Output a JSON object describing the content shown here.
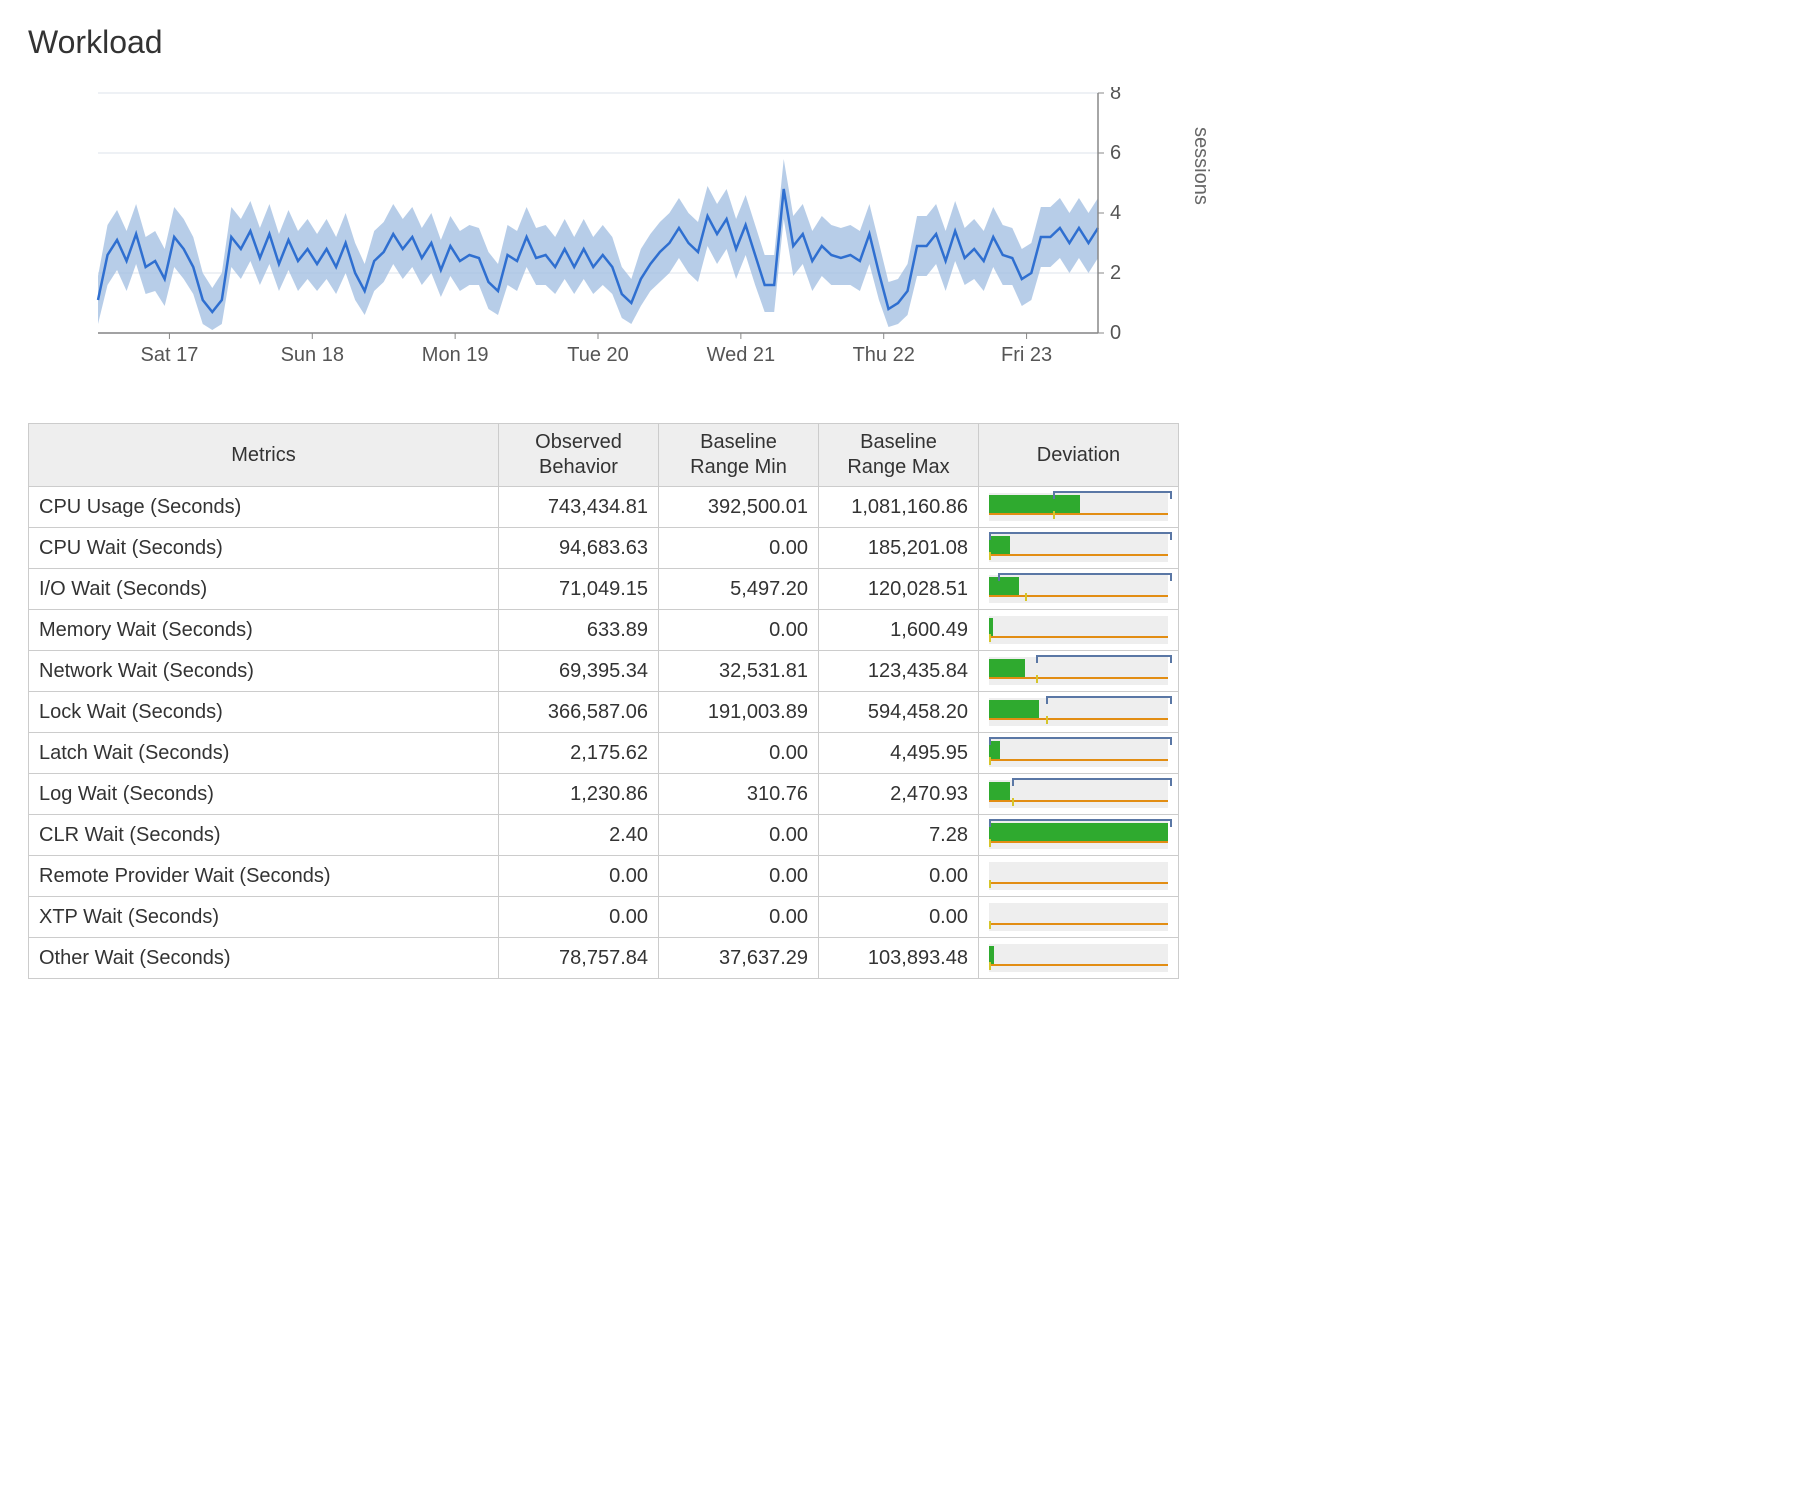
{
  "title": "Workload",
  "chart_axis_label": "sessions",
  "chart_data": {
    "type": "line",
    "title": "",
    "xlabel": "",
    "ylabel": "sessions",
    "ylim": [
      0,
      8
    ],
    "y_ticks": [
      0,
      2,
      4,
      6,
      8
    ],
    "categories": [
      "Sat 17",
      "Sun 18",
      "Mon 19",
      "Tue 20",
      "Wed 21",
      "Thu 22",
      "Fri 23"
    ],
    "series": [
      {
        "name": "sessions",
        "values": [
          1.1,
          2.6,
          3.1,
          2.4,
          3.3,
          2.2,
          2.4,
          1.8,
          3.2,
          2.8,
          2.2,
          1.1,
          0.7,
          1.1,
          3.2,
          2.8,
          3.4,
          2.5,
          3.3,
          2.3,
          3.1,
          2.4,
          2.8,
          2.3,
          2.8,
          2.2,
          3.0,
          2.0,
          1.4,
          2.4,
          2.7,
          3.3,
          2.8,
          3.2,
          2.5,
          3.0,
          2.1,
          2.9,
          2.4,
          2.6,
          2.5,
          1.7,
          1.4,
          2.6,
          2.4,
          3.2,
          2.5,
          2.6,
          2.2,
          2.8,
          2.2,
          2.8,
          2.2,
          2.6,
          2.2,
          1.3,
          1.0,
          1.8,
          2.3,
          2.7,
          3.0,
          3.5,
          3.0,
          2.7,
          3.9,
          3.3,
          3.8,
          2.8,
          3.6,
          2.6,
          1.6,
          1.6,
          4.8,
          2.9,
          3.3,
          2.4,
          2.9,
          2.6,
          2.5,
          2.6,
          2.4,
          3.3,
          2.0,
          0.8,
          1.0,
          1.4,
          2.9,
          2.9,
          3.3,
          2.4,
          3.4,
          2.5,
          2.8,
          2.4,
          3.2,
          2.6,
          2.5,
          1.8,
          2.0,
          3.2,
          3.2,
          3.5,
          3.0,
          3.5,
          3.0,
          3.5
        ]
      },
      {
        "name": "band_lower",
        "values": [
          0.3,
          1.6,
          2.1,
          1.4,
          2.3,
          1.3,
          1.4,
          0.9,
          2.2,
          1.8,
          1.3,
          0.3,
          0.1,
          0.3,
          2.2,
          1.8,
          2.4,
          1.6,
          2.3,
          1.4,
          2.1,
          1.4,
          1.8,
          1.4,
          1.8,
          1.3,
          2.0,
          1.1,
          0.6,
          1.4,
          1.7,
          2.3,
          1.8,
          2.2,
          1.6,
          2.0,
          1.2,
          1.9,
          1.4,
          1.6,
          1.6,
          0.8,
          0.6,
          1.6,
          1.4,
          2.2,
          1.6,
          1.6,
          1.3,
          1.8,
          1.3,
          1.8,
          1.3,
          1.6,
          1.3,
          0.5,
          0.3,
          0.9,
          1.4,
          1.7,
          2.0,
          2.5,
          2.0,
          1.7,
          2.9,
          2.3,
          2.8,
          1.8,
          2.6,
          1.6,
          0.7,
          0.7,
          3.8,
          1.9,
          2.3,
          1.4,
          1.9,
          1.6,
          1.6,
          1.6,
          1.4,
          2.3,
          1.1,
          0.2,
          0.3,
          0.6,
          1.9,
          1.9,
          2.3,
          1.4,
          2.4,
          1.6,
          1.8,
          1.4,
          2.2,
          1.6,
          1.6,
          0.9,
          1.1,
          2.2,
          2.2,
          2.5,
          2.0,
          2.5,
          2.0,
          2.5
        ]
      },
      {
        "name": "band_upper",
        "values": [
          1.9,
          3.6,
          4.1,
          3.4,
          4.3,
          3.2,
          3.4,
          2.8,
          4.2,
          3.8,
          3.2,
          2.0,
          1.5,
          2.0,
          4.2,
          3.8,
          4.4,
          3.5,
          4.3,
          3.3,
          4.1,
          3.4,
          3.8,
          3.3,
          3.8,
          3.2,
          4.0,
          3.0,
          2.3,
          3.4,
          3.7,
          4.3,
          3.8,
          4.2,
          3.5,
          4.0,
          3.1,
          3.9,
          3.4,
          3.6,
          3.5,
          2.7,
          2.3,
          3.6,
          3.4,
          4.2,
          3.5,
          3.6,
          3.2,
          3.8,
          3.2,
          3.8,
          3.2,
          3.6,
          3.2,
          2.2,
          1.8,
          2.8,
          3.3,
          3.7,
          4.0,
          4.5,
          4.0,
          3.7,
          4.9,
          4.3,
          4.8,
          3.8,
          4.6,
          3.6,
          2.6,
          2.6,
          5.8,
          3.9,
          4.3,
          3.4,
          3.9,
          3.6,
          3.5,
          3.6,
          3.4,
          4.3,
          3.0,
          1.7,
          1.8,
          2.3,
          3.9,
          3.9,
          4.3,
          3.4,
          4.4,
          3.5,
          3.8,
          3.4,
          4.2,
          3.6,
          3.5,
          2.8,
          3.0,
          4.2,
          4.2,
          4.5,
          4.0,
          4.5,
          4.0,
          4.5
        ]
      }
    ]
  },
  "table": {
    "headers": {
      "metrics": "Metrics",
      "observed": "Observed\nBehavior",
      "baseline_min": "Baseline\nRange Min",
      "baseline_max": "Baseline\nRange Max",
      "deviation": "Deviation"
    },
    "rows": [
      {
        "name": "CPU Usage (Seconds)",
        "observed": "743,434.81",
        "min": "392,500.01",
        "max": "1,081,160.86",
        "dev_pct": 51,
        "bracket_from": 36,
        "bracket_to": 100,
        "base_tick": 36
      },
      {
        "name": "CPU Wait (Seconds)",
        "observed": "94,683.63",
        "min": "0.00",
        "max": "185,201.08",
        "dev_pct": 12,
        "bracket_from": 0,
        "bracket_to": 100,
        "base_tick": 0
      },
      {
        "name": "I/O Wait (Seconds)",
        "observed": "71,049.15",
        "min": "5,497.20",
        "max": "120,028.51",
        "dev_pct": 17,
        "bracket_from": 5,
        "bracket_to": 100,
        "base_tick": 20
      },
      {
        "name": "Memory Wait (Seconds)",
        "observed": "633.89",
        "min": "0.00",
        "max": "1,600.49",
        "dev_pct": 2,
        "bracket_from": 0,
        "bracket_to": 0,
        "base_tick": 0
      },
      {
        "name": "Network Wait (Seconds)",
        "observed": "69,395.34",
        "min": "32,531.81",
        "max": "123,435.84",
        "dev_pct": 20,
        "bracket_from": 26,
        "bracket_to": 100,
        "base_tick": 26
      },
      {
        "name": "Lock Wait (Seconds)",
        "observed": "366,587.06",
        "min": "191,003.89",
        "max": "594,458.20",
        "dev_pct": 28,
        "bracket_from": 32,
        "bracket_to": 100,
        "base_tick": 32
      },
      {
        "name": "Latch Wait (Seconds)",
        "observed": "2,175.62",
        "min": "0.00",
        "max": "4,495.95",
        "dev_pct": 6,
        "bracket_from": 0,
        "bracket_to": 100,
        "base_tick": 0
      },
      {
        "name": "Log Wait (Seconds)",
        "observed": "1,230.86",
        "min": "310.76",
        "max": "2,470.93",
        "dev_pct": 12,
        "bracket_from": 13,
        "bracket_to": 100,
        "base_tick": 13
      },
      {
        "name": "CLR Wait (Seconds)",
        "observed": "2.40",
        "min": "0.00",
        "max": "7.28",
        "dev_pct": 100,
        "bracket_from": 0,
        "bracket_to": 100,
        "base_tick": 0
      },
      {
        "name": "Remote Provider Wait (Seconds)",
        "observed": "0.00",
        "min": "0.00",
        "max": "0.00",
        "dev_pct": 0,
        "bracket_from": 0,
        "bracket_to": 0,
        "base_tick": 0
      },
      {
        "name": "XTP Wait (Seconds)",
        "observed": "0.00",
        "min": "0.00",
        "max": "0.00",
        "dev_pct": 0,
        "bracket_from": 0,
        "bracket_to": 0,
        "base_tick": 0
      },
      {
        "name": "Other Wait (Seconds)",
        "observed": "78,757.84",
        "min": "37,637.29",
        "max": "103,893.48",
        "dev_pct": 3,
        "bracket_from": 0,
        "bracket_to": 0,
        "base_tick": 0
      }
    ]
  }
}
